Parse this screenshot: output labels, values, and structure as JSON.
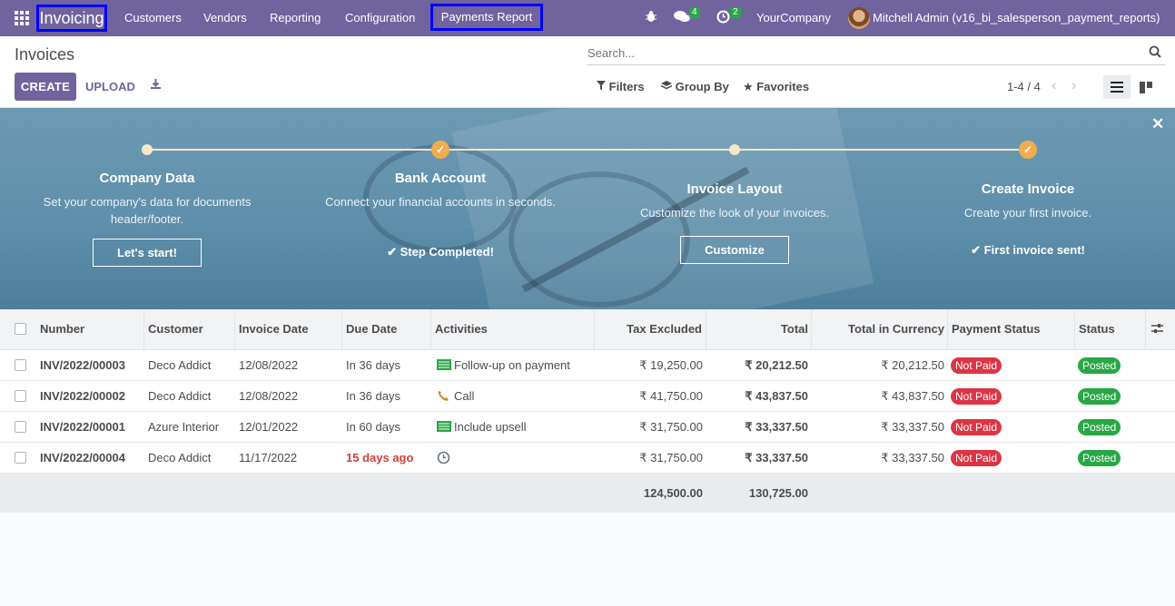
{
  "app": {
    "brand": "Invoicing",
    "menu": [
      "Customers",
      "Vendors",
      "Reporting",
      "Configuration"
    ],
    "highlight_menu": "Payments Report",
    "messages_count": "4",
    "activities_count": "2",
    "company": "YourCompany",
    "user": "Mitchell Admin (v16_bi_salesperson_payment_reports)"
  },
  "control": {
    "title": "Invoices",
    "create_label": "CREATE",
    "upload_label": "UPLOAD",
    "search_placeholder": "Search...",
    "filters_label": "Filters",
    "groupby_label": "Group By",
    "favorites_label": "Favorites",
    "pager": "1-4 / 4"
  },
  "onboarding": {
    "steps": [
      {
        "title": "Company Data",
        "desc": "Set your company's data for documents header/footer.",
        "action": "Let's start!",
        "done": false
      },
      {
        "title": "Bank Account",
        "desc": "Connect your financial accounts in seconds.",
        "action": "Step Completed!",
        "done": true
      },
      {
        "title": "Invoice Layout",
        "desc": "Customize the look of your invoices.",
        "action": "Customize",
        "done": false
      },
      {
        "title": "Create Invoice",
        "desc": "Create your first invoice.",
        "action": "First invoice sent!",
        "done": true
      }
    ]
  },
  "table": {
    "columns": [
      "Number",
      "Customer",
      "Invoice Date",
      "Due Date",
      "Activities",
      "Tax Excluded",
      "Total",
      "Total in Currency",
      "Payment Status",
      "Status"
    ],
    "rows": [
      {
        "number": "INV/2022/00003",
        "customer": "Deco Addict",
        "invoice_date": "12/08/2022",
        "due_date": "In 36 days",
        "activity": "Follow-up on payment",
        "activity_icon": "money-icon",
        "tax_excluded": "₹ 19,250.00",
        "total": "₹ 20,212.50",
        "total_currency": "₹ 20,212.50",
        "payment_status": "Not Paid",
        "status": "Posted"
      },
      {
        "number": "INV/2022/00002",
        "customer": "Deco Addict",
        "invoice_date": "12/08/2022",
        "due_date": "In 36 days",
        "activity": "Call",
        "activity_icon": "phone-icon",
        "tax_excluded": "₹ 41,750.00",
        "total": "₹ 43,837.50",
        "total_currency": "₹ 43,837.50",
        "payment_status": "Not Paid",
        "status": "Posted"
      },
      {
        "number": "INV/2022/00001",
        "customer": "Azure Interior",
        "invoice_date": "12/01/2022",
        "due_date": "In 60 days",
        "activity": "Include upsell",
        "activity_icon": "money-icon",
        "tax_excluded": "₹ 31,750.00",
        "total": "₹ 33,337.50",
        "total_currency": "₹ 33,337.50",
        "payment_status": "Not Paid",
        "status": "Posted"
      },
      {
        "number": "INV/2022/00004",
        "customer": "Deco Addict",
        "invoice_date": "11/17/2022",
        "due_date": "15 days ago",
        "activity": "",
        "activity_icon": "clock-icon",
        "tax_excluded": "₹ 31,750.00",
        "total": "₹ 33,337.50",
        "total_currency": "₹ 33,337.50",
        "payment_status": "Not Paid",
        "status": "Posted"
      }
    ],
    "totals": {
      "tax_excluded": "124,500.00",
      "total": "130,725.00"
    }
  },
  "colors": {
    "primary": "#71639e",
    "danger": "#dc3545",
    "success": "#28a745",
    "warning": "#f0ad4e"
  }
}
